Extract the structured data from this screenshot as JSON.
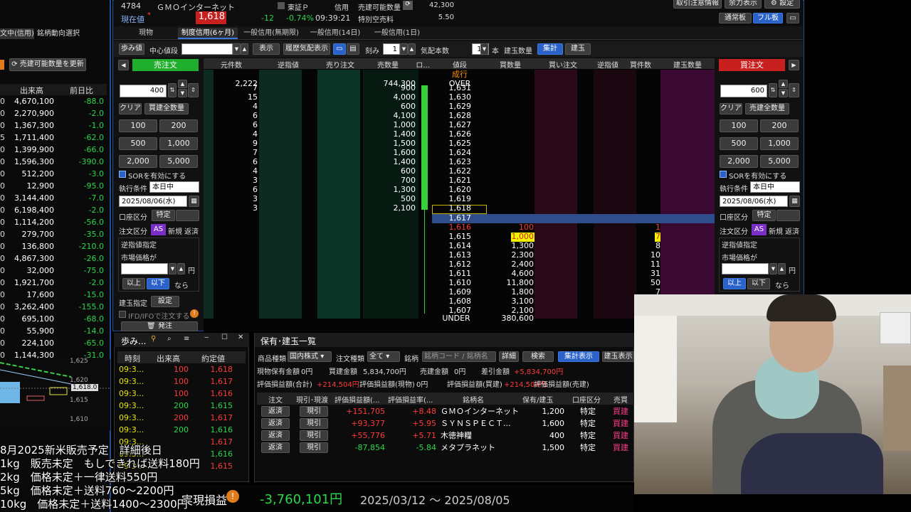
{
  "header": {
    "code": "4784",
    "name": "ＧＭＯインターネット",
    "market": "東証Ｐ",
    "credit": "信用",
    "avail_label": "売建可能数量",
    "avail_value": "42,300",
    "price_label": "現在値",
    "price": "1,618",
    "change": "-12",
    "change_pct": "-0.74%",
    "time": "09:39:21",
    "special_label": "特別空売料",
    "special_value": "5.50",
    "top_btns": [
      "取引注意情報",
      "余力表示",
      "設定"
    ],
    "mode_btns": [
      "通常板",
      "フル板"
    ]
  },
  "tabs": [
    "現物",
    "制度信用(6ヶ月)",
    "一般信用(無期限)",
    "一般信用(14日)",
    "一般信用(1日)"
  ],
  "left_tabs": [
    "文中(信用)",
    "銘柄動向選択"
  ],
  "left_update_btn": "売建可能数量を更新",
  "watchlist": {
    "headers": [
      "出来高",
      "前日比"
    ],
    "rows": [
      {
        "prefix": "0",
        "vol": "4,670,100",
        "chg": "-88.0"
      },
      {
        "prefix": "0",
        "vol": "2,270,900",
        "chg": "-2.0"
      },
      {
        "prefix": "0",
        "vol": "1,367,300",
        "chg": "-1.0"
      },
      {
        "prefix": "5",
        "vol": "1,711,400",
        "chg": "-62.0"
      },
      {
        "prefix": "0",
        "vol": "1,399,900",
        "chg": "-66.0"
      },
      {
        "prefix": "0",
        "vol": "1,596,300",
        "chg": "-390.0"
      },
      {
        "prefix": "0",
        "vol": "512,200",
        "chg": "-3.0"
      },
      {
        "prefix": "0",
        "vol": "12,900",
        "chg": "-95.0"
      },
      {
        "prefix": "0",
        "vol": "3,144,400",
        "chg": "-7.0"
      },
      {
        "prefix": "0",
        "vol": "6,198,400",
        "chg": "-2.0"
      },
      {
        "prefix": "0",
        "vol": "1,114,200",
        "chg": "-56.0"
      },
      {
        "prefix": "0",
        "vol": "279,700",
        "chg": "-35.0"
      },
      {
        "prefix": "0",
        "vol": "136,800",
        "chg": "-210.0"
      },
      {
        "prefix": "0",
        "vol": "4,867,300",
        "chg": "-26.0"
      },
      {
        "prefix": "0",
        "vol": "32,000",
        "chg": "-75.0"
      },
      {
        "prefix": "0",
        "vol": "1,921,700",
        "chg": "-2.0"
      },
      {
        "prefix": "0",
        "vol": "17,600",
        "chg": "-15.0"
      },
      {
        "prefix": "0",
        "vol": "3,262,400",
        "chg": "-155.0"
      },
      {
        "prefix": "0",
        "vol": "695,100",
        "chg": "-68.0"
      },
      {
        "prefix": "0",
        "vol": "55,900",
        "chg": "-14.0"
      },
      {
        "prefix": "0",
        "vol": "224,100",
        "chg": "-65.0"
      },
      {
        "prefix": "0",
        "vol": "1,144,300",
        "chg": "-31.0"
      }
    ]
  },
  "mini_chart": {
    "labels": [
      "1,625",
      "1,620",
      "1,615",
      "1,610"
    ],
    "current": "1,618.0"
  },
  "toolbar": {
    "mode": "歩み値",
    "center_label": "中心値段",
    "show": "表示",
    "history": "履歴気配表示",
    "tick_label": "刻み",
    "tick_value": "1",
    "quote_label": "気配本数",
    "quote_value": "15",
    "unit": "本",
    "tate_label": "建玉数量",
    "sum": "集計",
    "tate": "建玉"
  },
  "sell_panel": {
    "title": "売注文",
    "qty": "400",
    "clear": "クリア",
    "all": "買建全数量",
    "quick": [
      "100",
      "200",
      "500",
      "1,000",
      "2,000",
      "5,000"
    ],
    "sor": "SORを有効にする",
    "cond_label": "執行条件",
    "cond": "本日中",
    "date": "2025/08/06(水)",
    "acct_label": "口座区分",
    "acct": "特定",
    "type_label": "注文区分",
    "type_as": "AS",
    "type_new": "新規",
    "type_ret": "返済",
    "stop_title": "逆指値指定",
    "stop_sub": "市場価格が",
    "yen": "円",
    "above": "以上",
    "below": "以下",
    "nara": "なら",
    "tate_label": "建玉指定",
    "setting": "設定",
    "ifd": "IFD/IFOで注文する",
    "send": "発注"
  },
  "buy_panel": {
    "title": "買注文",
    "qty": "600",
    "clear": "クリア",
    "all": "売建全数量",
    "quick": [
      "100",
      "200",
      "500",
      "1,000",
      "2,000",
      "5,000"
    ],
    "sor": "SORを有効にする",
    "cond_label": "執行条件",
    "cond": "本日中",
    "date": "2025/08/06(水)",
    "acct_label": "口座区分",
    "acct": "特定",
    "type_label": "注文区分",
    "type_as": "AS",
    "type_new": "新規",
    "type_ret": "返済",
    "stop_title": "逆指値指定",
    "stop_sub": "市場価格が",
    "yen": "円",
    "above": "以上",
    "below": "以下",
    "nara": "なら"
  },
  "orderbook": {
    "headers": [
      "元件数",
      "逆指値",
      "売り注文",
      "売数量",
      "ロ...",
      "値段",
      "買数量",
      "買い注文",
      "逆指値",
      "買件数",
      "建玉数量"
    ],
    "market": "成行",
    "over_label": "OVER",
    "over_qty": "744,300",
    "over_cnt": "2,222",
    "under_label": "UNDER",
    "under_qty": "380,600",
    "asks": [
      {
        "cnt": "7",
        "qty": "900",
        "price": "1,631"
      },
      {
        "cnt": "15",
        "qty": "4,000",
        "price": "1,630"
      },
      {
        "cnt": "4",
        "qty": "600",
        "price": "1,629"
      },
      {
        "cnt": "6",
        "qty": "4,100",
        "price": "1,628"
      },
      {
        "cnt": "6",
        "qty": "1,000",
        "price": "1,627"
      },
      {
        "cnt": "4",
        "qty": "1,400",
        "price": "1,626"
      },
      {
        "cnt": "9",
        "qty": "1,500",
        "price": "1,625"
      },
      {
        "cnt": "7",
        "qty": "1,600",
        "price": "1,624"
      },
      {
        "cnt": "6",
        "qty": "1,400",
        "price": "1,623"
      },
      {
        "cnt": "4",
        "qty": "600",
        "price": "1,622"
      },
      {
        "cnt": "3",
        "qty": "700",
        "price": "1,621"
      },
      {
        "cnt": "6",
        "qty": "1,300",
        "price": "1,620"
      },
      {
        "cnt": "3",
        "qty": "500",
        "price": "1,619"
      },
      {
        "cnt": "3",
        "qty": "2,100",
        "price": "1,618"
      }
    ],
    "mid": "1,617",
    "bids": [
      {
        "price": "1,616",
        "qty": "100",
        "cnt": "1"
      },
      {
        "price": "1,615",
        "qty": "1,000",
        "cnt": "7"
      },
      {
        "price": "1,614",
        "qty": "1,300",
        "cnt": "8"
      },
      {
        "price": "1,613",
        "qty": "2,300",
        "cnt": "10"
      },
      {
        "price": "1,612",
        "qty": "2,400",
        "cnt": "11"
      },
      {
        "price": "1,611",
        "qty": "4,600",
        "cnt": "31"
      },
      {
        "price": "1,610",
        "qty": "11,800",
        "cnt": "50"
      },
      {
        "price": "1,609",
        "qty": "1,800",
        "cnt": "7"
      },
      {
        "price": "1,608",
        "qty": "3,100",
        "cnt": ""
      },
      {
        "price": "1,607",
        "qty": "2,100",
        "cnt": ""
      }
    ]
  },
  "ticks": {
    "title": "歩み...",
    "headers": [
      "時刻",
      "出来高",
      "約定値"
    ],
    "rows": [
      {
        "t": "09:3...",
        "v": "100",
        "p": "1,618",
        "c": "red"
      },
      {
        "t": "09:3...",
        "v": "100",
        "p": "1,617",
        "c": "red"
      },
      {
        "t": "09:3...",
        "v": "100",
        "p": "1,616",
        "c": "red"
      },
      {
        "t": "09:3...",
        "v": "200",
        "p": "1,615",
        "c": "green"
      },
      {
        "t": "09:3...",
        "v": "200",
        "p": "1,617",
        "c": "red"
      },
      {
        "t": "09:3...",
        "v": "200",
        "p": "1,616",
        "c": "green"
      },
      {
        "t": "09:3...",
        "v": "",
        "p": "1,617",
        "c": "red"
      },
      {
        "t": "09:3...",
        "v": "",
        "p": "1,616",
        "c": "green"
      },
      {
        "t": "09:3...",
        "v": "",
        "p": "1,615",
        "c": "red"
      }
    ]
  },
  "holdings": {
    "title": "保有･建玉一覧",
    "filter_cat": "商品種類",
    "filter_cat_val": "国内株式",
    "filter_type": "注文種類",
    "filter_type_val": "全て",
    "filter_sym": "銘柄",
    "filter_sym_ph": "銘柄コード / 銘柄名",
    "detail": "詳細",
    "search": "検索",
    "sum_btn": "集計表示",
    "tate_btn": "建玉表示",
    "summary": [
      {
        "k": "現物保有金額",
        "v": "0円"
      },
      {
        "k": "買建金額",
        "v": "5,834,700円"
      },
      {
        "k": "売建金額",
        "v": "0円"
      },
      {
        "k": "差引金額",
        "v": "+5,834,700円"
      }
    ],
    "summary2": [
      {
        "k": "評価損益額(合計)",
        "v": "+214,504円"
      },
      {
        "k": "評価損益額(現物)",
        "v": "0円"
      },
      {
        "k": "評価損益額(買建)",
        "v": "+214,504円"
      },
      {
        "k": "評価損益額(売建)",
        "v": ""
      }
    ],
    "headers": [
      "注文",
      "現引･現渡",
      "評価損益額(...",
      "評価損益率(...",
      "銘柄名",
      "保有/建玉",
      "口座区分",
      "売買"
    ],
    "rows": [
      {
        "a": "返済",
        "b": "現引",
        "pl": "+151,705",
        "pct": "+8.48",
        "name": "ＧＭＯインターネット",
        "qty": "1,200",
        "acct": "特定",
        "side": "買建",
        "c": "red"
      },
      {
        "a": "返済",
        "b": "現引",
        "pl": "+93,377",
        "pct": "+5.95",
        "name": "ＳＹＮＳＰＥＣＴ...",
        "qty": "1,600",
        "acct": "特定",
        "side": "買建",
        "c": "red"
      },
      {
        "a": "返済",
        "b": "現引",
        "pl": "+55,776",
        "pct": "+5.71",
        "name": "木徳神糧",
        "qty": "400",
        "acct": "特定",
        "side": "買建",
        "c": "red"
      },
      {
        "a": "返済",
        "b": "現引",
        "pl": "-87,854",
        "pct": "-5.84",
        "name": "メタプラネット",
        "qty": "1,500",
        "acct": "特定",
        "side": "買建",
        "c": "green"
      }
    ]
  },
  "bottom": {
    "label": "実現損益",
    "amount": "-3,760,101円",
    "range": "2025/03/12 ～ 2025/08/05"
  },
  "overlay_lines": [
    "8月2025新米販売予定　詳細後日",
    "1kg　販売未定　もしできれば送料180円",
    "2kg　価格未定＋一律送料550円",
    "5kg　価格未定＋送料760～2200円",
    "10kg　価格未定＋送料1400～2300円"
  ],
  "colors": {
    "accent": "#2a62c9",
    "sell": "#1fae2d",
    "buy": "#c81f1f",
    "up": "#ff3b3b",
    "down": "#2bd84a"
  }
}
